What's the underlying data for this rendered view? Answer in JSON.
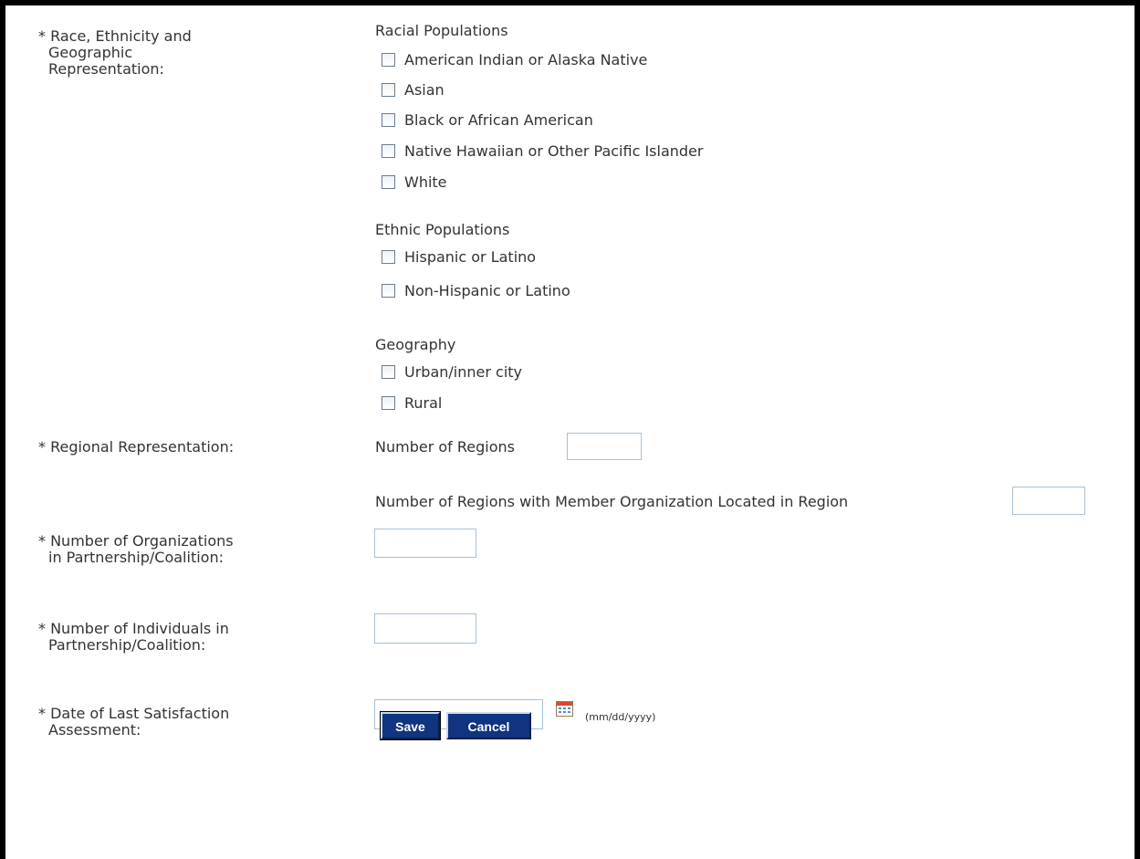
{
  "labels": {
    "race": [
      "* Race, Ethnicity and",
      "Geographic",
      "Representation:"
    ],
    "regional": [
      "* Regional Representation:"
    ],
    "orgs": [
      "* Number of Organizations",
      "in Partnership/Coalition:"
    ],
    "individuals": [
      "* Number of Individuals in",
      "Partnership/Coalition:"
    ],
    "date": [
      "* Date of Last Satisfaction",
      "Assessment:"
    ]
  },
  "racial": {
    "heading": "Racial Populations",
    "options": [
      {
        "label": "American Indian or Alaska Native",
        "checked": false
      },
      {
        "label": "Asian",
        "checked": false
      },
      {
        "label": "Black or African American",
        "checked": false
      },
      {
        "label": "Native Hawaiian or Other Pacific Islander",
        "checked": false
      },
      {
        "label": "White",
        "checked": false
      }
    ]
  },
  "ethnic": {
    "heading": "Ethnic Populations",
    "options": [
      {
        "label": "Hispanic or Latino",
        "checked": false
      },
      {
        "label": "Non-Hispanic or Latino",
        "checked": false
      }
    ]
  },
  "geography": {
    "heading": "Geography",
    "options": [
      {
        "label": "Urban/inner city",
        "checked": false
      },
      {
        "label": "Rural",
        "checked": false
      }
    ]
  },
  "regional": {
    "num_regions_label": "Number of Regions",
    "num_regions_value": "",
    "regions_with_member_label": "Number of Regions with Member Organization Located in Region",
    "regions_with_member_value": ""
  },
  "orgs": {
    "value": ""
  },
  "individuals": {
    "value": ""
  },
  "date": {
    "value": "",
    "format_hint": "(mm/dd/yyyy)",
    "icon": "calendar-icon"
  },
  "buttons": {
    "save": "Save",
    "cancel": "Cancel"
  },
  "colors": {
    "button_bg": "#10347f",
    "field_border": "#a8c0d6",
    "frame": "#000000"
  }
}
